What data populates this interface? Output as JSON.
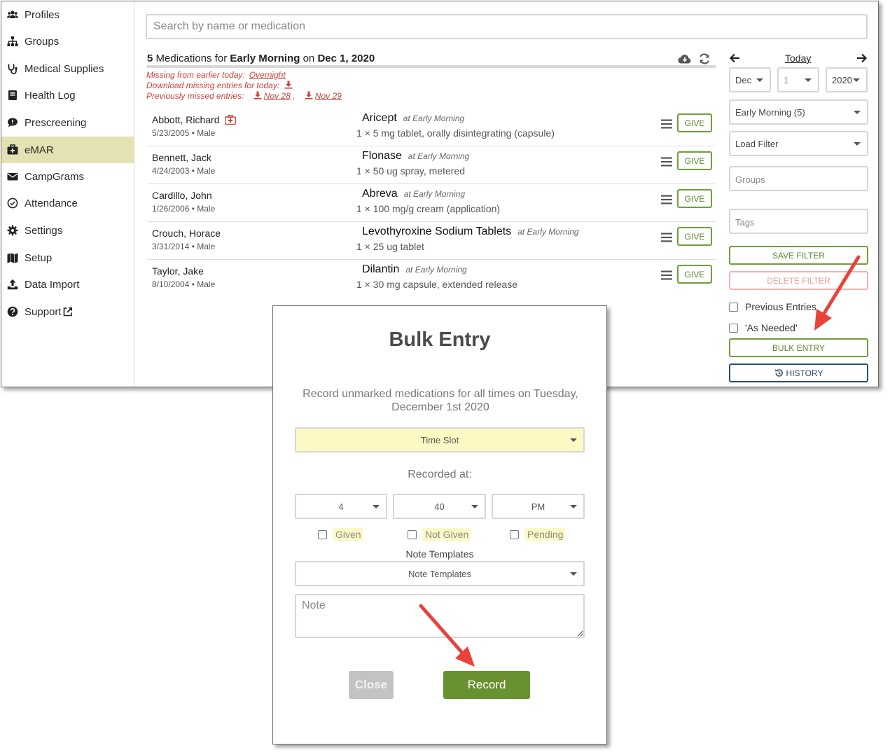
{
  "sidebar": {
    "items": [
      {
        "label": "Profiles",
        "icon": "users-icon"
      },
      {
        "label": "Groups",
        "icon": "sitemap-icon"
      },
      {
        "label": "Medical Supplies",
        "icon": "stethoscope-icon"
      },
      {
        "label": "Health Log",
        "icon": "book-icon"
      },
      {
        "label": "Prescreening",
        "icon": "comment-icon"
      },
      {
        "label": "eMAR",
        "icon": "medkit-icon",
        "active": true
      },
      {
        "label": "CampGrams",
        "icon": "envelope-icon"
      },
      {
        "label": "Attendance",
        "icon": "check-circle-icon"
      },
      {
        "label": "Settings",
        "icon": "gear-icon"
      },
      {
        "label": "Setup",
        "icon": "map-icon"
      },
      {
        "label": "Data Import",
        "icon": "upload-icon"
      },
      {
        "label": "Support",
        "icon": "question-circle-icon"
      }
    ]
  },
  "search": {
    "placeholder": "Search by name or medication"
  },
  "header": {
    "count": "5",
    "text1": "Medications for",
    "timeslot": "Early Morning",
    "text2": "on",
    "date": "Dec 1, 2020"
  },
  "notices": {
    "missing_label": "Missing from earlier today:",
    "missing_link": "Overnight",
    "download_label": "Download missing entries for today:",
    "prev_label": "Previously missed entries:",
    "prev_1": "Nov 28",
    "prev_sep": ",",
    "prev_2": "Nov 29"
  },
  "medications": [
    {
      "name": "Abbott, Richard",
      "info": "5/23/2005 • Male",
      "drug": "Aricept",
      "when": "at Early Morning",
      "dose": "1 × 5 mg tablet, orally disintegrating (capsule)",
      "give": "GIVE",
      "alert": true
    },
    {
      "name": "Bennett, Jack",
      "info": "4/24/2003 • Male",
      "drug": "Flonase",
      "when": "at Early Morning",
      "dose": "1 × 50 ug spray, metered",
      "give": "GIVE"
    },
    {
      "name": "Cardillo, John",
      "info": "1/26/2006 • Male",
      "drug": "Abreva",
      "when": "at Early Morning",
      "dose": "1 × 100 mg/g cream (application)",
      "give": "GIVE"
    },
    {
      "name": "Crouch, Horace",
      "info": "3/31/2014 • Male",
      "drug": "Levothyroxine Sodium Tablets",
      "when": "at Early Morning",
      "dose": "1 × 25 ug tablet",
      "give": "GIVE"
    },
    {
      "name": "Taylor, Jake",
      "info": "8/10/2004 • Male",
      "drug": "Dilantin",
      "when": "at Early Morning",
      "dose": "1 × 30 mg capsule, extended release",
      "give": "GIVE"
    }
  ],
  "panel": {
    "today": "Today",
    "month": "Dec",
    "day": "1",
    "year": "2020",
    "timeslot": "Early Morning (5)",
    "load_filter": "Load Filter",
    "groups_placeholder": "Groups",
    "tags_placeholder": "Tags",
    "save_filter": "SAVE FILTER",
    "delete_filter": "DELETE FILTER",
    "previous_entries": "Previous Entries",
    "as_needed": "'As Needed'",
    "bulk_entry": "BULK ENTRY",
    "history": "HISTORY"
  },
  "modal": {
    "title": "Bulk Entry",
    "description": "Record unmarked medications for all times on Tuesday, December 1st 2020",
    "time_slot": "Time Slot",
    "recorded_at": "Recorded at:",
    "hour": "4",
    "minute": "40",
    "ampm": "PM",
    "given": "Given",
    "not_given": "Not Given",
    "pending": "Pending",
    "note_templates_label": "Note Templates",
    "note_templates_select": "Note Templates",
    "note_placeholder": "Note",
    "close": "Close",
    "record": "Record"
  },
  "colors": {
    "active_nav": "#e4e2b3",
    "give_green": "#6e9f3b",
    "record_green": "#69912f",
    "alert_red": "#d0413a",
    "highlight_yellow": "#fcf9c4",
    "annotation_red": "#e8423a"
  }
}
